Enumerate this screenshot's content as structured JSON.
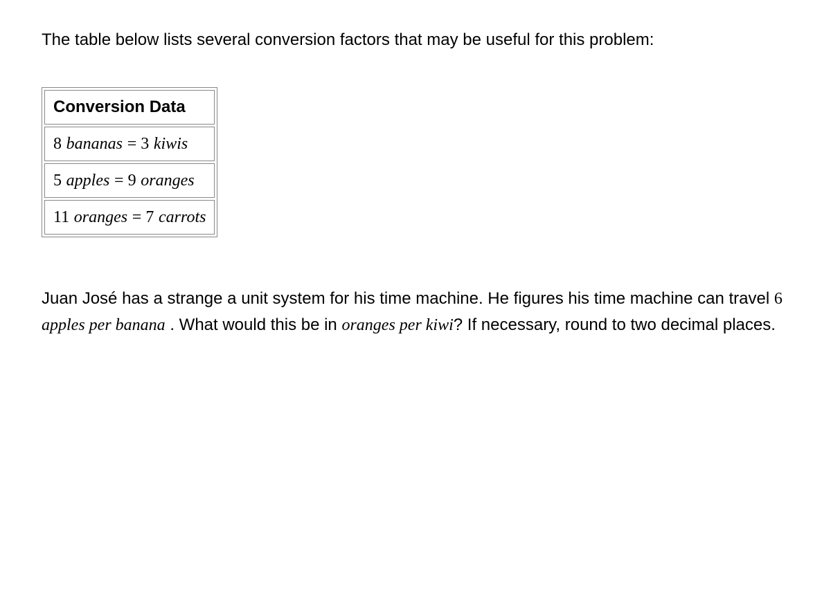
{
  "intro": "The table below lists several conversion factors that may be useful for this problem:",
  "table": {
    "header": "Conversion Data",
    "rows": [
      {
        "left_num": "8",
        "left_unit": "bananas",
        "right_num": "3",
        "right_unit": "kiwis"
      },
      {
        "left_num": "5",
        "left_unit": "apples",
        "right_num": "9",
        "right_unit": "oranges"
      },
      {
        "left_num": "11",
        "left_unit": "oranges",
        "right_num": "7",
        "right_unit": "carrots"
      }
    ]
  },
  "question": {
    "part1": "Juan José has a strange a unit system for his time machine. He figures his time machine can travel ",
    "rate_num": "6",
    "rate_unit": "apples per banana",
    "part2": " . What would this be in ",
    "target_unit": "oranges per kiwi",
    "part3": "? If necessary, round to two decimal places."
  }
}
